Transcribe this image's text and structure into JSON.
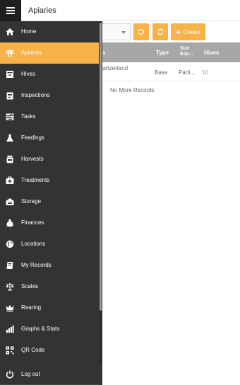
{
  "header": {
    "title": "Apiaries",
    "menu_icon": "hamburger-icon"
  },
  "toolbar": {
    "create_label": "Create",
    "accent": "#f7b24a"
  },
  "table": {
    "columns": {
      "first": "s",
      "type": "Type",
      "sun_exposure": "Sun Exp...",
      "hives": "Hives"
    },
    "rows": [
      {
        "location": "witzerland",
        "type": "Base",
        "sun_exposure": "Parti...",
        "hives": "10"
      }
    ],
    "footer": "No More Records"
  },
  "sidebar": {
    "items": [
      {
        "label": "Home",
        "icon": "home-icon"
      },
      {
        "label": "Apiaries",
        "icon": "apiary-icon",
        "active": true
      },
      {
        "label": "Hives",
        "icon": "hive-icon"
      },
      {
        "label": "Inspections",
        "icon": "clipboard-icon"
      },
      {
        "label": "Tasks",
        "icon": "tasks-icon"
      },
      {
        "label": "Feedings",
        "icon": "flask-icon"
      },
      {
        "label": "Harvests",
        "icon": "jar-icon"
      },
      {
        "label": "Treatments",
        "icon": "medkit-icon"
      },
      {
        "label": "Storage",
        "icon": "warehouse-icon"
      },
      {
        "label": "Finances",
        "icon": "money-bag-icon"
      },
      {
        "label": "Locations",
        "icon": "globe-icon"
      },
      {
        "label": "My Records",
        "icon": "book-icon"
      },
      {
        "label": "Scales",
        "icon": "scale-icon"
      },
      {
        "label": "Rearing",
        "icon": "crown-icon"
      },
      {
        "label": "Graphs & Stats",
        "icon": "bar-chart-icon"
      },
      {
        "label": "QR Code",
        "icon": "qr-code-icon"
      }
    ],
    "logout": {
      "label": "Log out",
      "icon": "power-icon"
    }
  }
}
